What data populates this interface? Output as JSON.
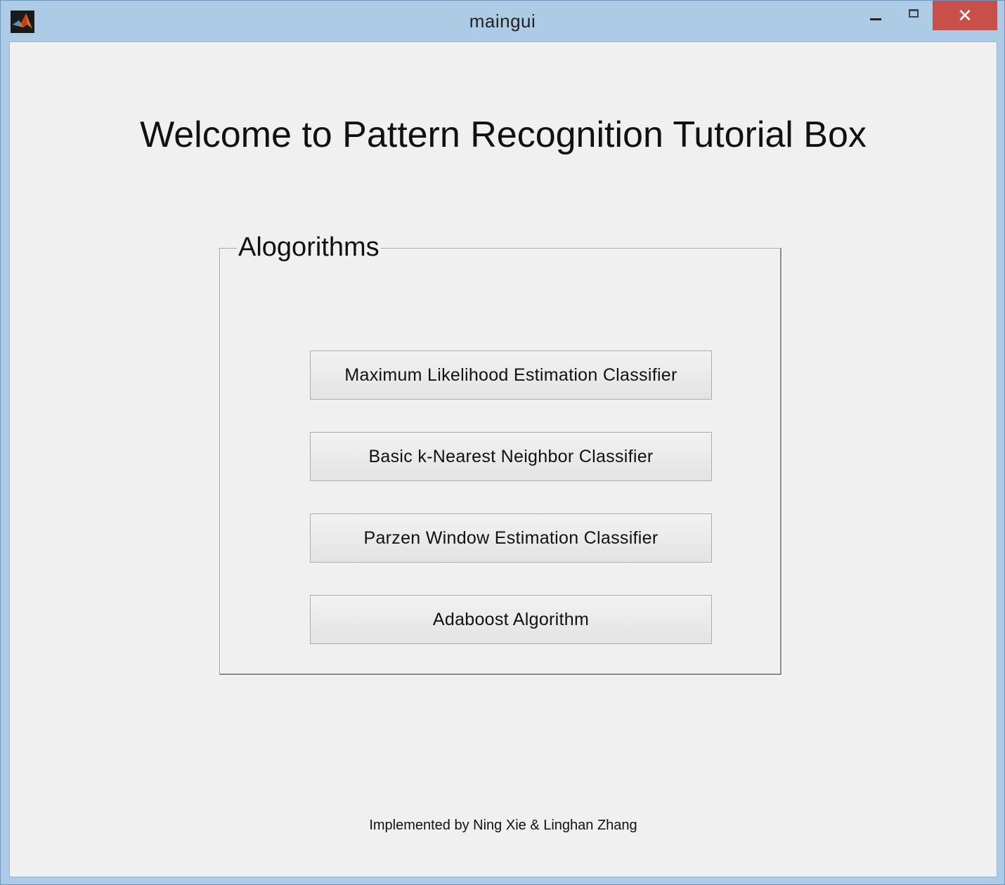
{
  "window": {
    "title": "maingui",
    "controls": {
      "minimize_icon": "minimize-icon",
      "maximize_icon": "maximize-icon",
      "close_label": "✕"
    }
  },
  "main": {
    "heading": "Welcome to Pattern Recognition Tutorial Box",
    "panel": {
      "title": "Alogorithms",
      "buttons": [
        "Maximum Likelihood Estimation Classifier",
        "Basic k-Nearest Neighbor Classifier",
        "Parzen Window Estimation Classifier",
        "Adaboost Algorithm"
      ]
    },
    "footer": "Implemented by Ning Xie & Linghan Zhang"
  },
  "colors": {
    "window_frame": "#aecbe6",
    "client_bg": "#f0f0f0",
    "close_button": "#c7504a"
  }
}
